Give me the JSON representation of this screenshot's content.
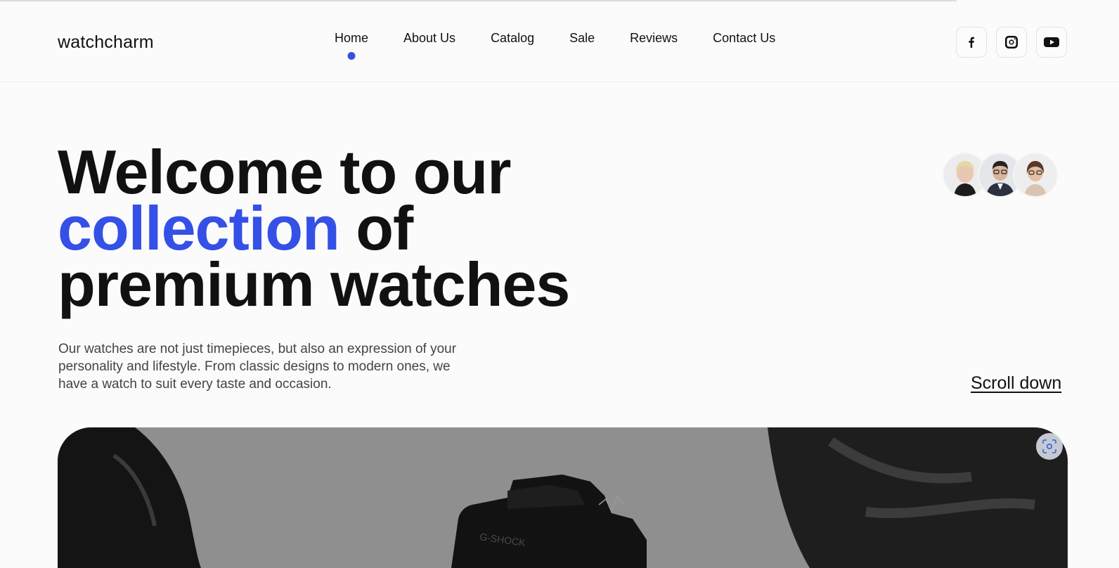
{
  "header": {
    "logo": "watchcharm",
    "nav": [
      {
        "label": "Home",
        "active": true
      },
      {
        "label": "About Us"
      },
      {
        "label": "Catalog"
      },
      {
        "label": "Sale"
      },
      {
        "label": "Reviews"
      },
      {
        "label": "Contact Us"
      }
    ],
    "socials": [
      "facebook-icon",
      "instagram-icon",
      "youtube-icon"
    ],
    "accent_color": "#3550e6"
  },
  "hero": {
    "title_line1": "Welcome to our",
    "title_accent": "collection",
    "title_of": " of",
    "title_line3": "premium watches",
    "description": "Our watches are not just timepieces, but also an expression of your personality and lifestyle. From classic designs to modern ones, we have a watch to suit every taste and occasion.",
    "scroll_label": "Scroll down",
    "avatars": [
      "avatar-woman-blonde",
      "avatar-man-glasses",
      "avatar-woman-glasses"
    ]
  },
  "page_progress": 0.855
}
